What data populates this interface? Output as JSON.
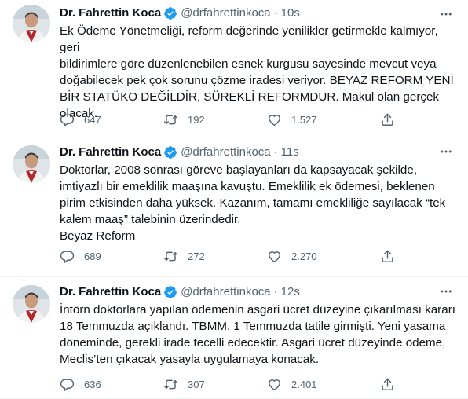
{
  "colors": {
    "verified": "#1d9bf0",
    "secondary": "#536471",
    "text": "#0f1419",
    "divider": "#eff3f4"
  },
  "icons": {
    "reply": "reply-icon",
    "retweet": "retweet-icon",
    "like": "heart-icon",
    "share": "share-icon",
    "more": "more-icon",
    "verified": "verified-badge-icon"
  },
  "tweets": [
    {
      "name": "Dr. Fahrettin Koca",
      "handle": "@drfahrettinkoca",
      "dot": "·",
      "time": "10s",
      "text": "Ek Ödeme Yönetmeliği, reform değerinde yenilikler getirmekle kalmıyor, geri\nbildirimlere göre düzenlenebilen esnek kurgusu sayesinde mevcut veya\ndoğabilecek pek çok sorunu çözme iradesi veriyor. BEYAZ REFORM YENİ\nBİR STATÜKO DEĞİLDİR, SÜREKLİ REFORMDUR. Makul olan gerçek\nolacak.",
      "replies": "647",
      "retweets": "192",
      "likes": "1.527"
    },
    {
      "name": "Dr. Fahrettin Koca",
      "handle": "@drfahrettinkoca",
      "dot": "·",
      "time": "11s",
      "text": "Doktorlar, 2008 sonrası göreve başlayanları da kapsayacak şekilde,\nimtiyazlı bir emeklilik maaşına kavuştu. Emeklilik ek ödemesi, beklenen\npirim etkisinden daha yüksek. Kazanım, tamamı emekliliğe sayılacak “tek\nkalem maaş” talebinin üzerindedir.\nBeyaz Reform",
      "replies": "689",
      "retweets": "272",
      "likes": "2.270"
    },
    {
      "name": "Dr. Fahrettin Koca",
      "handle": "@drfahrettinkoca",
      "dot": "·",
      "time": "12s",
      "text": "İntörn doktorlara yapılan ödemenin asgari ücret düzeyine çıkarılması kararı\n18 Temmuzda açıklandı. TBMM, 1 Temmuzda tatile girmişti. Yeni yasama\ndöneminde, gerekli irade tecelli edecektir. Asgari ücret düzeyinde ödeme,\nMeclis’ten çıkacak yasayla uygulamaya konacak.",
      "replies": "636",
      "retweets": "307",
      "likes": "2.401"
    }
  ]
}
